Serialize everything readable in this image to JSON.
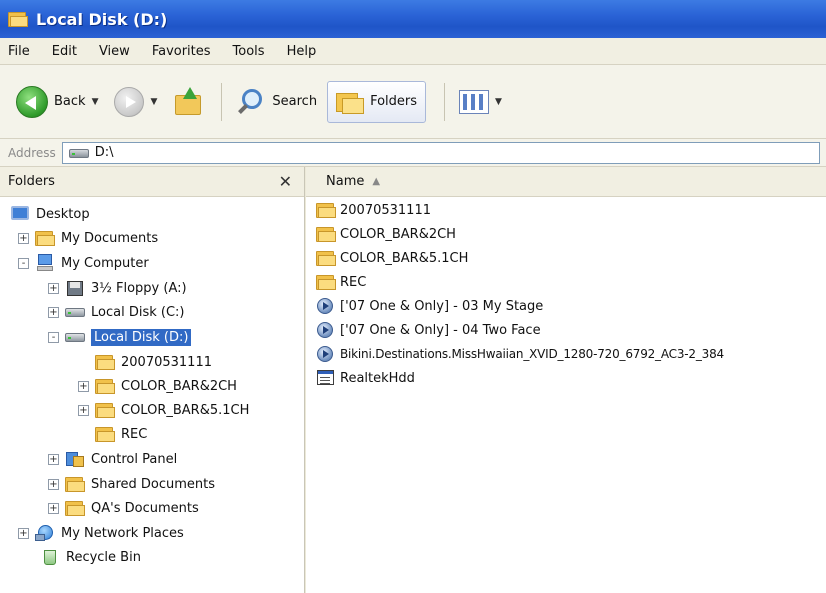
{
  "window": {
    "title": "Local Disk (D:)"
  },
  "menu": [
    "File",
    "Edit",
    "View",
    "Favorites",
    "Tools",
    "Help"
  ],
  "toolbar": {
    "back": "Back",
    "search": "Search",
    "folders": "Folders"
  },
  "address": {
    "label": "Address",
    "value": "D:\\"
  },
  "folders_pane": {
    "title": "Folders",
    "tree": [
      {
        "label": "Desktop",
        "icon": "desktop-icon",
        "expander": ""
      },
      {
        "label": "My Documents",
        "icon": "folder-icon",
        "expander": "+"
      },
      {
        "label": "My Computer",
        "icon": "computer-icon",
        "expander": "-"
      },
      {
        "label": "3½ Floppy (A:)",
        "icon": "floppy-icon",
        "expander": "+"
      },
      {
        "label": "Local Disk (C:)",
        "icon": "drive-icon",
        "expander": "+"
      },
      {
        "label": "Local Disk (D:)",
        "icon": "drive-icon",
        "expander": "-"
      },
      {
        "label": "20070531111",
        "icon": "folder-icon",
        "expander": ""
      },
      {
        "label": "COLOR_BAR&2CH",
        "icon": "folder-icon",
        "expander": "+"
      },
      {
        "label": "COLOR_BAR&5.1CH",
        "icon": "folder-icon",
        "expander": "+"
      },
      {
        "label": "REC",
        "icon": "folder-icon",
        "expander": ""
      },
      {
        "label": "Control Panel",
        "icon": "control-panel-icon",
        "expander": "+"
      },
      {
        "label": "Shared Documents",
        "icon": "folder-icon",
        "expander": "+"
      },
      {
        "label": "QA's Documents",
        "icon": "folder-icon",
        "expander": "+"
      },
      {
        "label": "My Network Places",
        "icon": "network-icon",
        "expander": "+"
      },
      {
        "label": "Recycle Bin",
        "icon": "recycle-bin-icon",
        "expander": ""
      }
    ]
  },
  "file_list": {
    "column_header": "Name",
    "items": [
      {
        "name": "20070531111",
        "icon": "folder-icon"
      },
      {
        "name": "COLOR_BAR&2CH",
        "icon": "folder-icon"
      },
      {
        "name": "COLOR_BAR&5.1CH",
        "icon": "folder-icon"
      },
      {
        "name": "REC",
        "icon": "folder-icon"
      },
      {
        "name": "['07 One & Only] - 03 My Stage",
        "icon": "media-file-icon"
      },
      {
        "name": "['07 One & Only] - 04 Two Face",
        "icon": "media-file-icon"
      },
      {
        "name": "Bikini.Destinations.MissHwaiian_XVID_1280-720_6792_AC3-2_384",
        "icon": "media-file-icon"
      },
      {
        "name": "RealtekHdd",
        "icon": "application-file-icon"
      }
    ]
  }
}
